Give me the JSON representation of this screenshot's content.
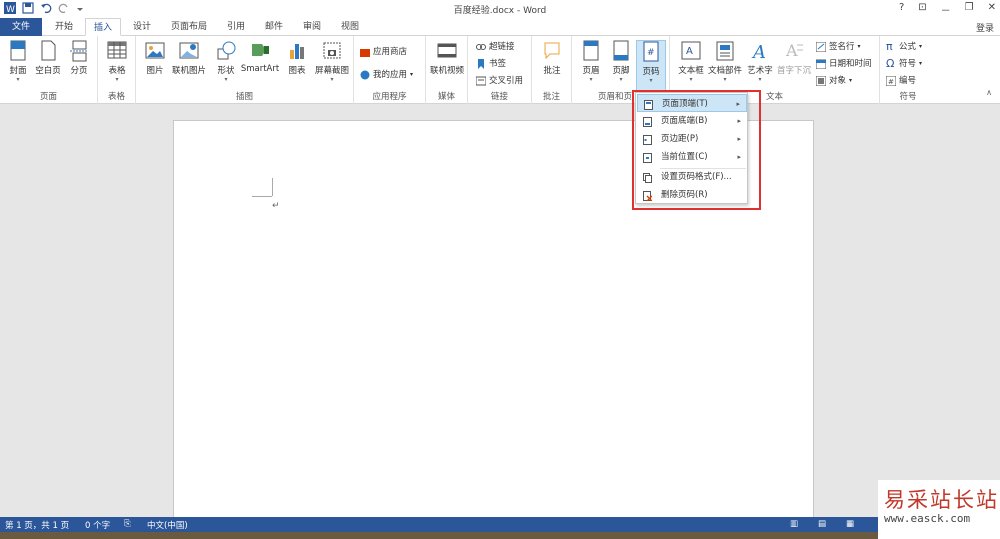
{
  "titlebar": {
    "title": "百度经验.docx - Word",
    "help": "?",
    "ribbon_display": "⊡",
    "minimize": "－",
    "restore": "❐",
    "close": "✕"
  },
  "tabs": [
    "文件",
    "开始",
    "插入",
    "设计",
    "页面布局",
    "引用",
    "邮件",
    "审阅",
    "视图"
  ],
  "login": "登录",
  "ribbon": {
    "groups": {
      "pages": "页面",
      "tables": "表格",
      "illustrations": "插图",
      "apps": "应用程序",
      "media": "媒体",
      "links": "链接",
      "comments": "批注",
      "header_footer": "页眉和页",
      "text": "文本",
      "symbols": "符号"
    },
    "buttons": {
      "cover": "封面",
      "blank_page": "空白页",
      "page_break": "分页",
      "table": "表格",
      "picture": "图片",
      "online_picture": "联机图片",
      "shapes": "形状",
      "smartart": "SmartArt",
      "chart": "图表",
      "screenshot": "屏幕截图",
      "app_store": "应用商店",
      "my_apps": "我的应用",
      "online_video": "联机视频",
      "hyperlink": "超链接",
      "bookmark": "书签",
      "cross_ref": "交叉引用",
      "comment": "批注",
      "header": "页眉",
      "footer": "页脚",
      "page_number": "页码",
      "textbox": "文本框",
      "quick_parts": "文档部件",
      "wordart": "艺术字",
      "dropcap": "首字下沉",
      "signature": "签名行",
      "datetime": "日期和时间",
      "object": "对象",
      "equation": "公式",
      "symbol": "符号",
      "number": "编号"
    }
  },
  "menu": {
    "items": [
      {
        "label": "页面顶端(T)",
        "has_sub": true
      },
      {
        "label": "页面底端(B)",
        "has_sub": true
      },
      {
        "label": "页边距(P)",
        "has_sub": true
      },
      {
        "label": "当前位置(C)",
        "has_sub": true
      },
      {
        "label": "设置页码格式(F)...",
        "has_sub": false
      },
      {
        "label": "删除页码(R)",
        "has_sub": false
      }
    ],
    "submenu_arrow": "▸"
  },
  "document": {
    "caret": "↵"
  },
  "status": {
    "page": "第 1 页，共 1 页",
    "words": "0 个字",
    "lang": "中文(中国)"
  },
  "watermark": {
    "line1": "易采站长站",
    "line2": "www.easck.com"
  },
  "colors": {
    "brand": "#2b579a",
    "highlight_box": "#e03030",
    "menu_hover": "#cde6f7"
  }
}
